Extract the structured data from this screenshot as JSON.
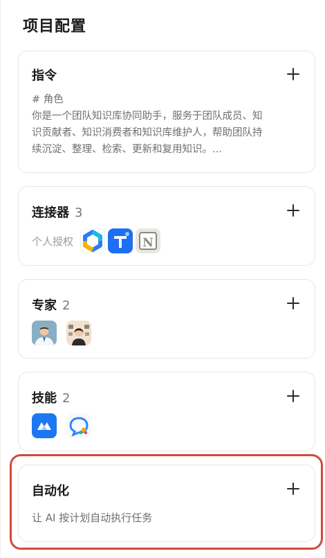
{
  "page": {
    "title": "项目配置"
  },
  "instructions": {
    "title": "指令",
    "heading_line": "# 角色",
    "lines": [
      "你是一个团队知识库协同助手，服务于团队成员、知",
      "识贡献者、知识消费者和知识库维护人，帮助团队持",
      "续沉淀、整理、检索、更新和复用知识。..."
    ],
    "add_icon": "plus-icon"
  },
  "connectors": {
    "title": "连接器",
    "count": "3",
    "auth_label": "个人授权",
    "icons": [
      "hexagon-app-icon",
      "blue-arrow-app-icon",
      "notion-icon"
    ]
  },
  "experts": {
    "title": "专家",
    "count": "2",
    "icons": [
      "expert-doctor-avatar",
      "expert-group-avatar"
    ]
  },
  "skills": {
    "title": "技能",
    "count": "2",
    "icons": [
      "blue-cloud-app-icon",
      "chat-bubble-app-icon"
    ]
  },
  "automation": {
    "title": "自动化",
    "description": "让 AI 按计划自动执行任务",
    "highlight_color": "#d24a3a"
  }
}
